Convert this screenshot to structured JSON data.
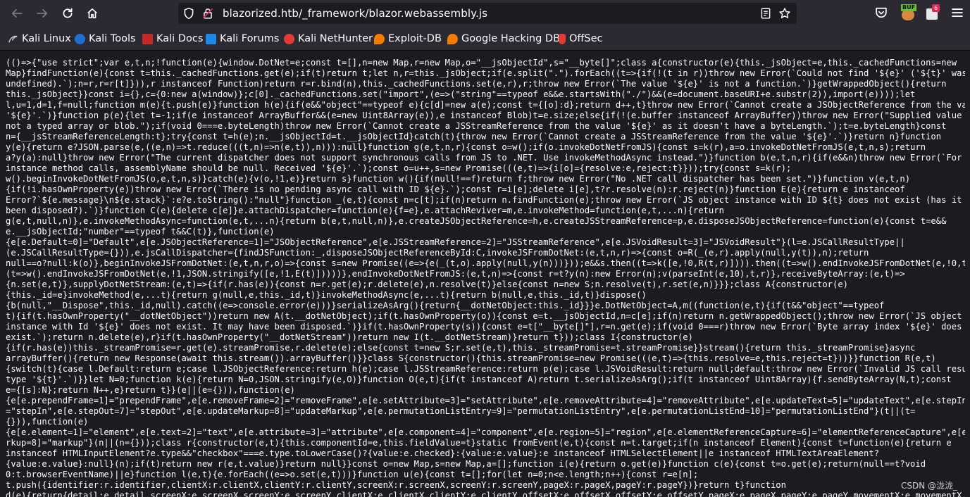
{
  "browser": {
    "url": "blazorized.htb/_framework/blazor.webassembly.js",
    "extension_badge_1": "BUF",
    "extension_badge_2": "6"
  },
  "bookmarks": [
    {
      "label": "Kali Linux",
      "icon": "kali-linux-icon",
      "color": "#2f7bd9"
    },
    {
      "label": "Kali Tools",
      "icon": "kali-tools-icon",
      "color": "#e53935"
    },
    {
      "label": "Kali Docs",
      "icon": "kali-docs-icon",
      "color": "#d32f2f"
    },
    {
      "label": "Kali Forums",
      "icon": "kali-forums-icon",
      "color": "#1e88e5"
    },
    {
      "label": "Kali NetHunter",
      "icon": "kali-nethunter-icon",
      "color": "#e53935"
    },
    {
      "label": "Exploit-DB",
      "icon": "exploit-db-icon",
      "color": "#f57c00"
    },
    {
      "label": "Google Hacking DB",
      "icon": "ghdb-icon",
      "color": "#f57c00"
    },
    {
      "label": "OffSec",
      "icon": "offsec-icon",
      "color": "#e53935"
    }
  ],
  "code_lines": [
    "(()=>{\"use strict\";var e,t,n;!function(e){window.DotNet=e;const t=[],n=new Map,r=new Map,o=\"__jsObjectId\",s=\"__byte[]\";class a{constructor(e){this._jsObject=e,this._cachedFunctions=new",
    "Map}findFunction(e){const t=this._cachedFunctions.get(e);if(t)return t;let n,r=this._jsObject;if(e.split(\".\").forEach((t=>{if(!(t in r))throw new Error(`Could not find '${e}' ('${t}' was",
    "undefined).`);n=r,r=r[t]})),r instanceof Function)return r=r.bind(n),this._cachedFunctions.set(e,r),r;throw new Error(`The value '${e}' is not a function.`)}getWrappedObject(){return",
    "this._jsObject}}const i={},c={0:new a(window)};c[0]._cachedFunctions.set(\"import\",(e=>(\"string\"==typeof e&&e.startsWith(\"./\")&&(e=document.baseURI+e.substr(2)),import(e))));let",
    "l,u=1,d=1,f=null;function m(e){t.push(e)}function h(e){if(e&&\"object\"==typeof e){c[d]=new a(e);const t={[o]:d};return d++,t}throw new Error(`Cannot create a JSObjectReference from the value",
    "'${e}'.`)}function p(e){let t=-1;if(e instanceof ArrayBuffer&&(e=new Uint8Array(e)),e instanceof Blob)t=e.size;else{if(!(e.buffer instanceof ArrayBuffer))throw new Error(\"Supplied value is",
    "not a typed array or blob.\");if(void 0===e.byteLength)throw new Error(`Cannot create a JSStreamReference from the value '${e}' as it doesn't have a byteLength.`);t=e.byteLength}const",
    "n={__jsStreamReferenceLength:t};try{const t=h(e);n.__jsObjectId=t.__jsObjectId}catch(t){throw new Error(`Cannot create a JSStreamReference from the value '${e}'.`)}return n}function",
    "y(e){return e?JSON.parse(e,((e,n)=>t.reduce(((t,n)=>n(e,t)),n))):null}function g(e,t,n,r){const o=w();if(o.invokeDotNetFromJS){const s=k(r),a=o.invokeDotNetFromJS(e,t,n,s);return",
    "a?y(a):null}throw new Error(\"The current dispatcher does not support synchronous calls from JS to .NET. Use invokeMethodAsync instead.\")}function b(e,t,n,r){if(e&&n)throw new Error(`For",
    "instance method calls, assemblyName should be null. Received '${e}'.`);const o=u++,s=new Promise(((e,t)=>{i[o]={resolve:e,reject:t}}));try{const s=k(r);",
    "w().beginInvokeDotNetFromJS(o,e,t,n,s)}catch(e){v(o,!1,e)}return s}function w(){if(null!==f)return f;throw new Error(\"No .NET call dispatcher has been set.\")}function v(e,t,n)",
    "{if(!i.hasOwnProperty(e))throw new Error(`There is no pending async call with ID ${e}.`);const r=i[e];delete i[e],t?r.resolve(n):r.reject(n)}function E(e){return e instanceof",
    "Error?`${e.message}\\n${e.stack}`:e?e.toString():\"null\"}function _(e,t){const n=c[t];if(n)return n.findFunction(e);throw new Error(`JS object instance with ID ${t} does not exist (has it",
    "been disposed?).`)}function C(e){delete c[e]}e.attachDispatcher=function(e){f=e},e.attachReviver=m,e.invokeMethod=function(e,t,...n){return",
    "g(e,t,null,n)},e.invokeMethodAsync=function(e,t,...n){return b(e,t,null,n)},e.createJSObjectReference=h,e.createJSStreamReference=p,e.disposeJSObjectReference=function(e){const t=e&&",
    "e.__jsObjectId;\"number\"==typeof t&&C(t)},function(e)",
    "{e[e.Default=0]=\"Default\",e[e.JSObjectReference=1]=\"JSObjectReference\",e[e.JSStreamReference=2]=\"JSStreamReference\",e[e.JSVoidResult=3]=\"JSVoidResult\"}(l=e.JSCallResultType||",
    "(e.JSCallResultType={})),e.jsCallDispatcher={findJSFunction:_,disposeJSObjectReferenceById:C,invokeJSFromDotNet:(e,t,n,r)=>{const o=R(_(e,r).apply(null,y(t)),n);return",
    "null==o?null:k(o)},beginInvokeJSFromDotNet:(e,t,n,r,o)=>{const s=new Promise((e=>{e(_(t,o).apply(null,y(n)))}));e&&s.then((t=>k([e,!0,R(t,r)]))).then((t=>w().endInvokeJSFromDotNet(e,!0,t)),",
    "(t=>w().endInvokeJSFromDotNet(e,!1,JSON.stringify([e,!1,E(t)]))))},endInvokeDotNetFromJS:(e,t,n)=>{const r=t?y(n):new Error(n);v(parseInt(e,10),t,r)},receiveByteArray:(e,t)=>",
    "{n.set(e,t)},supplyDotNetStream:(e,t)=>{if(r.has(e)){const n=r.get(e);r.delete(e),n.resolve(t)}else{const n=new S;n.resolve(t),r.set(e,n)}}};class A{constructor(e)",
    "{this._id=e}invokeMethod(e,...t){return g(null,e,this._id,t)}invokeMethodAsync(e,...t){return b(null,e,this._id,t)}dispose()",
    "{b(null,\"__Dispose\",this._id,null).catch((e=>console.error(e)))}serializeAsArg(){return{__dotNetObject:this._id}}}e.DotNetObject=A,m((function(e,t){if(t&&\"object\"==typeof",
    "t){if(t.hasOwnProperty(\"__dotNetObject\"))return new A(t.__dotNetObject);if(t.hasOwnProperty(o)){const e=t.__jsObjectId,n=c[e];if(n)return n.getWrappedObject();throw new Error(`JS object",
    "instance with Id '${e}' does not exist. It may have been disposed.`)}if(t.hasOwnProperty(s)){const e=t[\"__byte[]\"],r=n.get(e);if(void 0===r)throw new Error(`Byte array index '${e}' does not",
    "exist.`);return n.delete(e),r}if(t.hasOwnProperty(\"__dotNetStream\"))return new I(t.__dotNetStream)}return t}));class I{constructor(e)",
    "{if(r.has(e))this._streamPromise=r.get(e).streamPromise,r.delete(e);else{const t=new S;r.set(e,t),this._streamPromise=t.streamPromise}}stream(){return this._streamPromise}async",
    "arrayBuffer(){return new Response(await this.stream()).arrayBuffer()}}class S{constructor(){this.streamPromise=new Promise(((e,t)=>{this.resolve=e,this.reject=t}))}}function R(e,t)",
    "{switch(t){case l.Default:return e;case l.JSObjectReference:return h(e);case l.JSStreamReference:return p(e);case l.JSVoidResult:return null;default:throw new Error(`Invalid JS call result",
    "type '${t}'.`)}}let N=0;function k(e){return N=0,JSON.stringify(e,O)}function O(e,t){if(t instanceof A)return t.serializeAsArg();if(t instanceof Uint8Array){f.sendByteArray(N,t);const",
    "e={[s]:N};return N++,e}return t}}(e||(e={})),function(e)",
    "{e[e.prependFrame=1]=\"prependFrame\",e[e.removeFrame=2]=\"removeFrame\",e[e.setAttribute=3]=\"setAttribute\",e[e.removeAttribute=4]=\"removeAttribute\",e[e.updateText=5]=\"updateText\",e[e.stepIn=6]",
    "=\"stepIn\",e[e.stepOut=7]=\"stepOut\",e[e.updateMarkup=8]=\"updateMarkup\",e[e.permutationListEntry=9]=\"permutationListEntry\",e[e.permutationListEnd=10]=\"permutationListEnd\"}(t||(t=",
    "{})),function(e)",
    "{e[e.element=1]=\"element\",e[e.text=2]=\"text\",e[e.attribute=3]=\"attribute\",e[e.component=4]=\"component\",e[e.region=5]=\"region\",e[e.elementReferenceCapture=6]=\"elementReferenceCapture\",e[e.ma",
    "rkup=8]=\"markup\"}(n||(n={}));class r{constructor(e,t){this.componentId=e,this.fieldValue=t}static fromEvent(e,t){const n=t.target;if(n instanceof Element){const t=function(e){return e",
    "instanceof HTMLInputElement?e.type&&\"checkbox\"===e.type.toLowerCase()?{value:e.checked}:{value:e.value}:e instanceof HTMLSelectElement||e instanceof HTMLTextAreaElement?",
    "{value:e.value}:null}(n);if(t)return new r(e,t.value)}return null}}const o=new Map,s=new Map,a=[];function i(e){return o.get(e)}function c(e){const t=o.get(e);return(null==t?void",
    "0:t.browserEventName)||e}function l(e,t){e.forEach((e=>o.set(e,t)))}function u(e){const t=[];for(let n=0;n<e.length;n++){const r=e[n];",
    "t.push({identifier:r.identifier,clientX:r.clientX,clientY:r.clientY,screenX:r.screenX,screenY:r.screenY,pageX:r.pageX,pageY:r.pageY})}return t}function",
    "d(e){return{detail:e.detail,screenX:e.screenX,screenY:e.screenY,clientX:e.clientX,clientY:e.clientY,offsetX:e.offsetX,offsetY:e.offsetY,pageX:e.pageX,pageY:e.pageY,movementX:e.movementX,mov"
  ],
  "watermark": "CSDN @泷泷_"
}
